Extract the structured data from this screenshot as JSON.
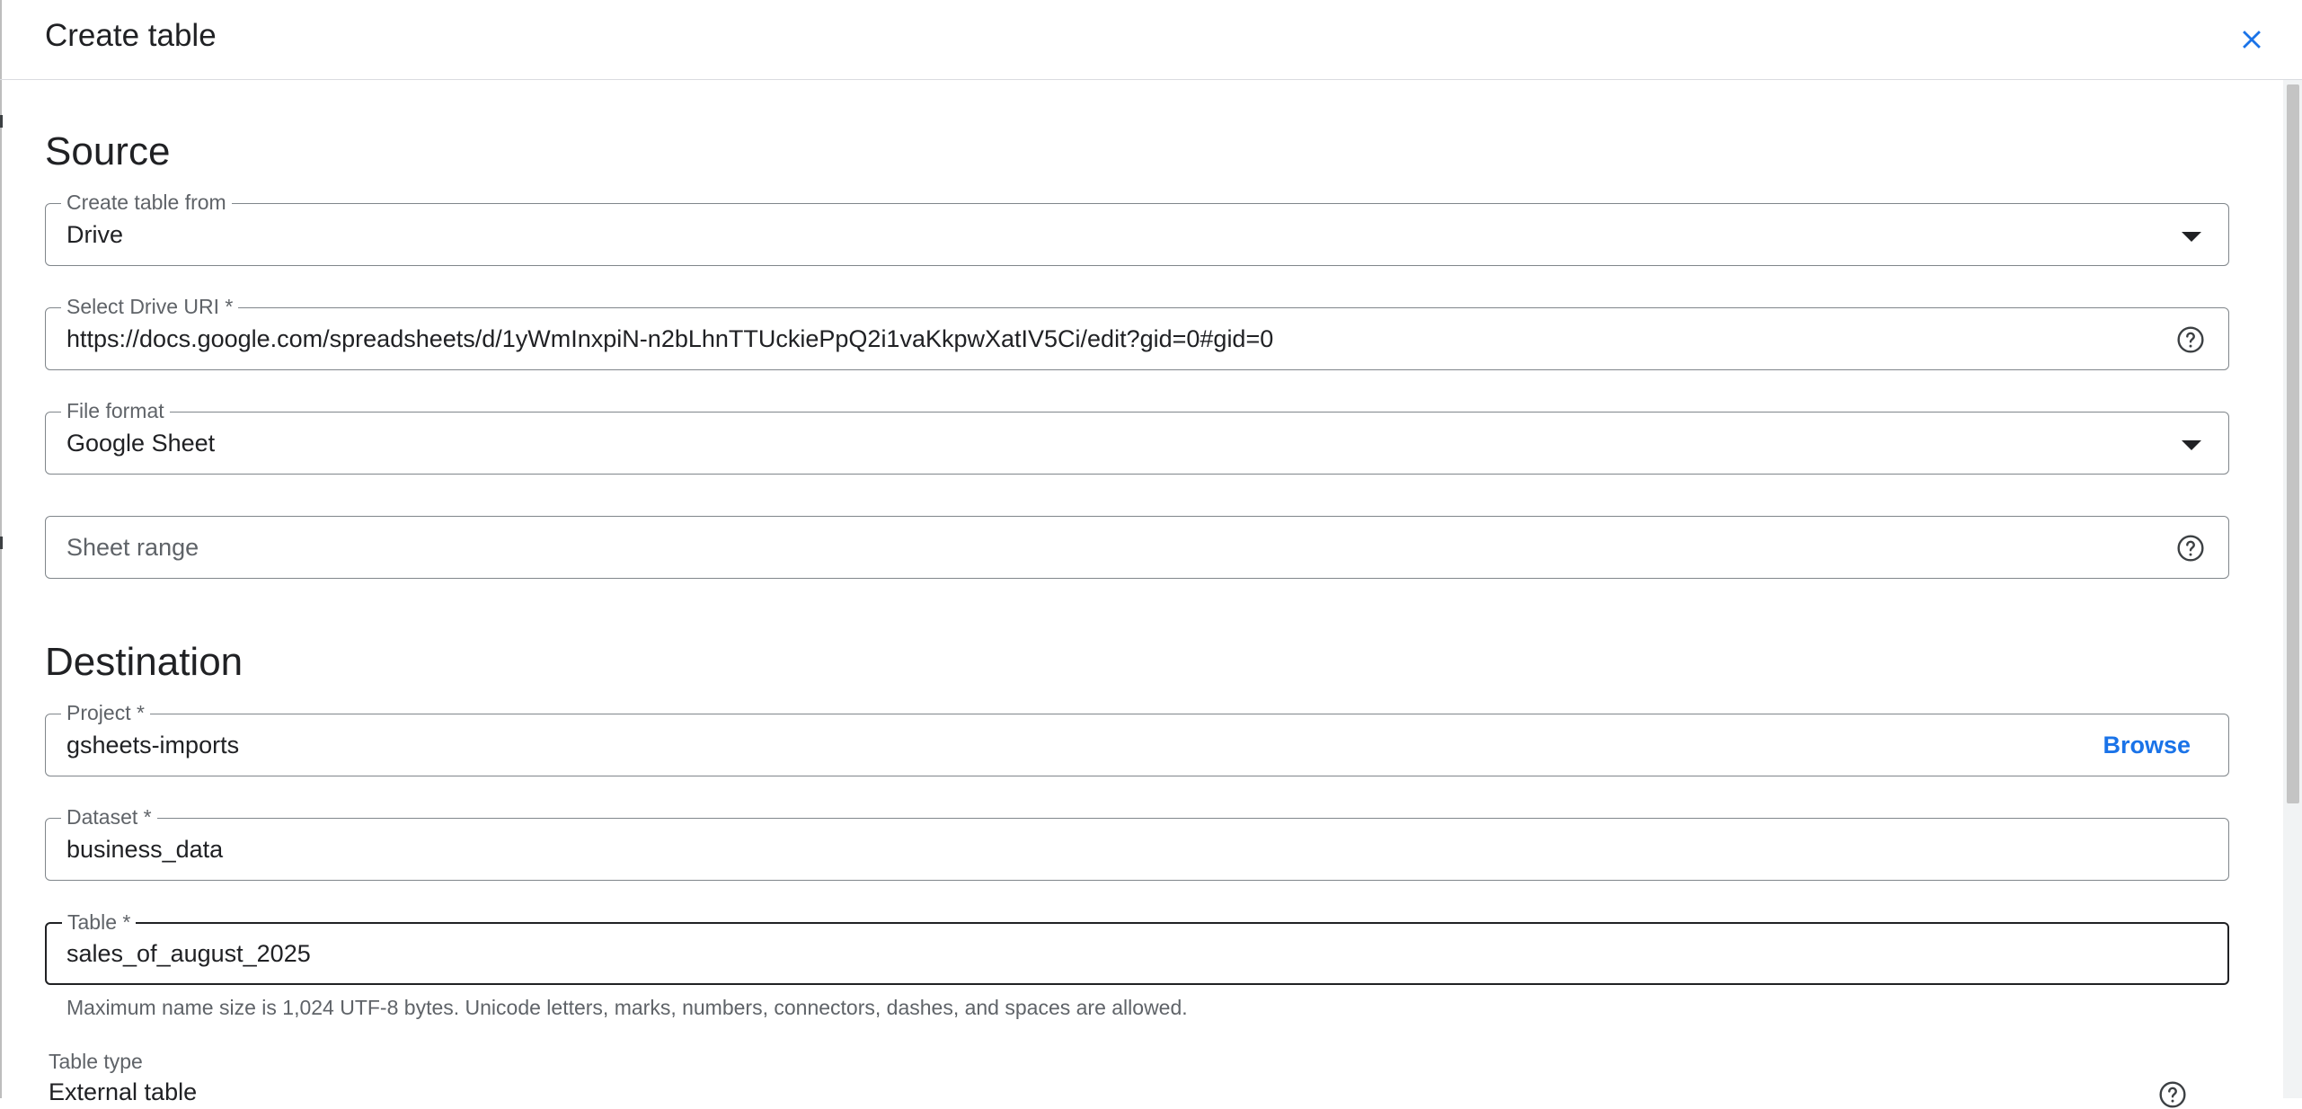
{
  "dialog": {
    "title": "Create table"
  },
  "source": {
    "heading": "Source",
    "create_from": {
      "label": "Create table from",
      "value": "Drive"
    },
    "drive_uri": {
      "label": "Select Drive URI *",
      "value": "https://docs.google.com/spreadsheets/d/1yWmInxpiN-n2bLhnTTUckiePpQ2i1vaKkpwXatIV5Ci/edit?gid=0#gid=0"
    },
    "file_format": {
      "label": "File format",
      "value": "Google Sheet"
    },
    "sheet_range": {
      "placeholder": "Sheet range"
    }
  },
  "destination": {
    "heading": "Destination",
    "project": {
      "label": "Project *",
      "value": "gsheets-imports",
      "browse_label": "Browse"
    },
    "dataset": {
      "label": "Dataset *",
      "value": "business_data"
    },
    "table": {
      "label": "Table *",
      "value": "sales_of_august_2025",
      "hint": "Maximum name size is 1,024 UTF-8 bytes. Unicode letters, marks, numbers, connectors, dashes, and spaces are allowed."
    },
    "table_type": {
      "label": "Table type",
      "value": "External table"
    }
  },
  "icons": {
    "close": "close-icon",
    "help": "help-circle-icon",
    "dropdown": "arrow-drop-down-icon"
  },
  "colors": {
    "accent": "#1a73e8",
    "border": "#80868b",
    "label": "#5f6368"
  }
}
